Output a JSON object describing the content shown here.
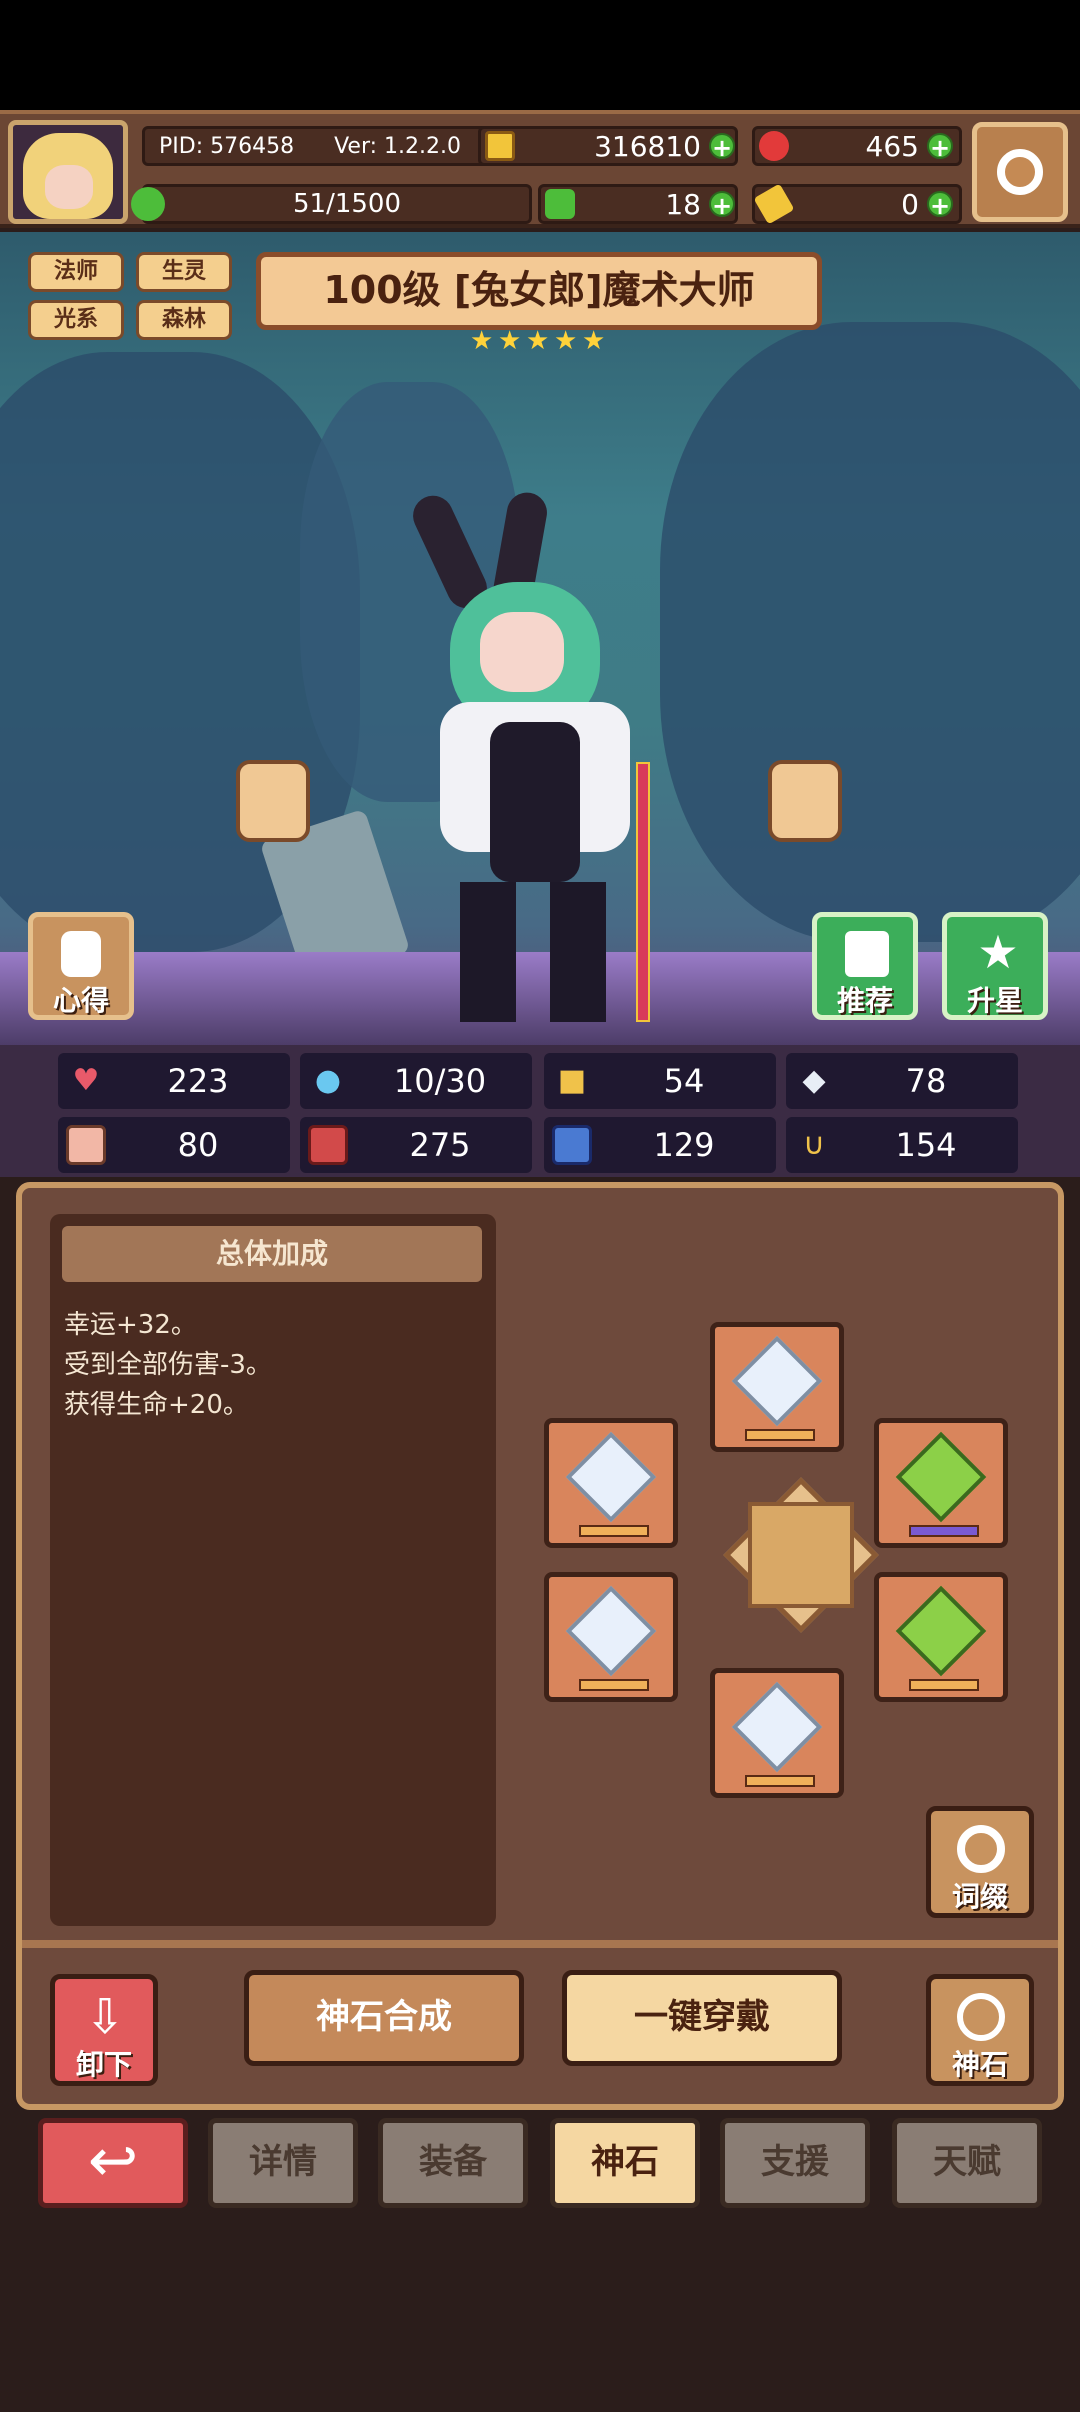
{
  "header": {
    "pid": "PID: 576458",
    "version": "Ver: 1.2.2.0",
    "coins": "316810",
    "gems": "465",
    "hp_bar": "51/1500",
    "clover": "18",
    "keys": "0"
  },
  "hero": {
    "title": "100级 [兔女郎]魔术大师",
    "tags": [
      "法师",
      "生灵",
      "光系",
      "森林"
    ],
    "star_count": 5
  },
  "scene_buttons": {
    "insight": "心得",
    "recommend": "推荐",
    "upgrade_star": "升星"
  },
  "stats": [
    {
      "icon": "heart-icon",
      "value": "223",
      "color": "#e85a6a"
    },
    {
      "icon": "water-drop-icon",
      "value": "10/30",
      "color": "#6ac8f0"
    },
    {
      "icon": "shield-icon",
      "value": "54",
      "color": "#f0c24a"
    },
    {
      "icon": "wing-icon",
      "value": "78",
      "color": "#e8eef6"
    },
    {
      "icon": "fist-icon",
      "value": "80",
      "color": "#f2b7a6"
    },
    {
      "icon": "book-icon",
      "value": "275",
      "color": "#d24a4a"
    },
    {
      "icon": "boot-icon",
      "value": "129",
      "color": "#4a7ad2"
    },
    {
      "icon": "horseshoe-icon",
      "value": "154",
      "color": "#f0c24a"
    }
  ],
  "bonus": {
    "title": "总体加成",
    "lines": [
      "幸运+32。",
      "受到全部伤害-3。",
      "获得生命+20。"
    ]
  },
  "panel_buttons": {
    "suffix": "词缀",
    "unequip": "卸下",
    "synthesize": "神石合成",
    "equip_all": "一键穿戴",
    "god_stone": "神石"
  },
  "tabs": [
    "详情",
    "装备",
    "神石",
    "支援",
    "天赋"
  ],
  "active_tab": "神石"
}
